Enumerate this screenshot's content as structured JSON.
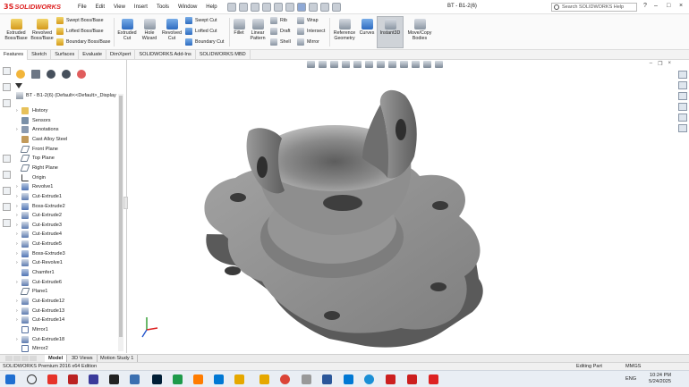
{
  "app": {
    "brand": "SOLIDWORKS",
    "brand_prefix": "3S",
    "menu": [
      "File",
      "Edit",
      "View",
      "Insert",
      "Tools",
      "Window",
      "Help"
    ],
    "document_title": "BT - B1-2(6)",
    "search_placeholder": "Search SOLIDWORKS Help"
  },
  "ribbon": {
    "buttons": [
      {
        "label_1": "Extruded",
        "label_2": "Boss/Base"
      },
      {
        "label_1": "Revolved",
        "label_2": "Boss/Base"
      },
      {
        "label_1": "Extruded",
        "label_2": "Cut"
      },
      {
        "label_1": "Hole",
        "label_2": "Wizard"
      },
      {
        "label_1": "Revolved",
        "label_2": "Cut"
      },
      {
        "label_1": "Fillet",
        "label_2": ""
      },
      {
        "label_1": "Linear",
        "label_2": "Pattern"
      },
      {
        "label_1": "Reference",
        "label_2": "Geometry"
      },
      {
        "label_1": "Curves",
        "label_2": ""
      },
      {
        "label_1": "Instant3D",
        "label_2": ""
      },
      {
        "label_1": "Move/Copy",
        "label_2": "Bodies"
      }
    ],
    "small_items": [
      "Swept Boss/Base",
      "Lofted Boss/Base",
      "Boundary Boss/Base",
      "Swept Cut",
      "Lofted Cut",
      "Boundary Cut",
      "Rib",
      "Draft",
      "Shell",
      "Wrap",
      "Intersect",
      "Mirror"
    ]
  },
  "tabs": [
    "Features",
    "Sketch",
    "Surfaces",
    "Evaluate",
    "DimXpert",
    "SOLIDWORKS Add-Ins",
    "SOLIDWORKS MBD"
  ],
  "tree": {
    "root": "BT - B1-2(6)  (Default<<Default>_Display",
    "items": [
      {
        "label": "History",
        "icon": "folder-icon",
        "expand": true
      },
      {
        "label": "Sensors",
        "icon": "sensor-icon",
        "expand": false
      },
      {
        "label": "Annotations",
        "icon": "annotation-icon",
        "expand": true
      },
      {
        "label": "Cast Alloy Steel",
        "icon": "material-icon",
        "expand": false
      },
      {
        "label": "Front Plane",
        "icon": "plane-icon",
        "expand": false
      },
      {
        "label": "Top Plane",
        "icon": "plane-icon",
        "expand": false
      },
      {
        "label": "Right Plane",
        "icon": "plane-icon",
        "expand": false
      },
      {
        "label": "Origin",
        "icon": "origin-icon",
        "expand": false
      },
      {
        "label": "Revolve1",
        "icon": "feature-icon",
        "expand": true
      },
      {
        "label": "Cut-Extrude1",
        "icon": "cut-icon",
        "expand": true
      },
      {
        "label": "Boss-Extrude2",
        "icon": "feature-icon",
        "expand": true
      },
      {
        "label": "Cut-Extrude2",
        "icon": "cut-icon",
        "expand": true
      },
      {
        "label": "Cut-Extrude3",
        "icon": "cut-icon",
        "expand": true
      },
      {
        "label": "Cut-Extrude4",
        "icon": "cut-icon",
        "expand": true
      },
      {
        "label": "Cut-Extrude5",
        "icon": "cut-icon",
        "expand": true
      },
      {
        "label": "Boss-Extrude3",
        "icon": "feature-icon",
        "expand": true
      },
      {
        "label": "Cut-Revolve1",
        "icon": "cut-icon",
        "expand": true
      },
      {
        "label": "Chamfer1",
        "icon": "feature-icon",
        "expand": false
      },
      {
        "label": "Cut-Extrude6",
        "icon": "cut-icon",
        "expand": true
      },
      {
        "label": "Plane1",
        "icon": "plane-icon",
        "expand": false
      },
      {
        "label": "Cut-Extrude12",
        "icon": "cut-icon",
        "expand": true
      },
      {
        "label": "Cut-Extrude13",
        "icon": "cut-icon",
        "expand": true
      },
      {
        "label": "Cut-Extrude14",
        "icon": "cut-icon",
        "expand": true
      },
      {
        "label": "Mirror1",
        "icon": "mirror-icon",
        "expand": false
      },
      {
        "label": "Cut-Extrude18",
        "icon": "cut-icon",
        "expand": true
      },
      {
        "label": "Mirror2",
        "icon": "mirror-icon",
        "expand": false
      }
    ]
  },
  "bottom_tabs": [
    "Model",
    "3D Views",
    "Motion Study 1"
  ],
  "statusbar": {
    "left": "SOLIDWORKS Premium 2016 x64 Edition",
    "mode": "Editing Part",
    "units": "MMGS"
  },
  "taskbar": {
    "language": "ENG",
    "time": "10:24 PM",
    "date": "5/24/2025"
  },
  "colors": {
    "brand_red": "#d22222",
    "model_grey": "#8c8c8c",
    "instant3d_active": "#cfd3d8"
  }
}
